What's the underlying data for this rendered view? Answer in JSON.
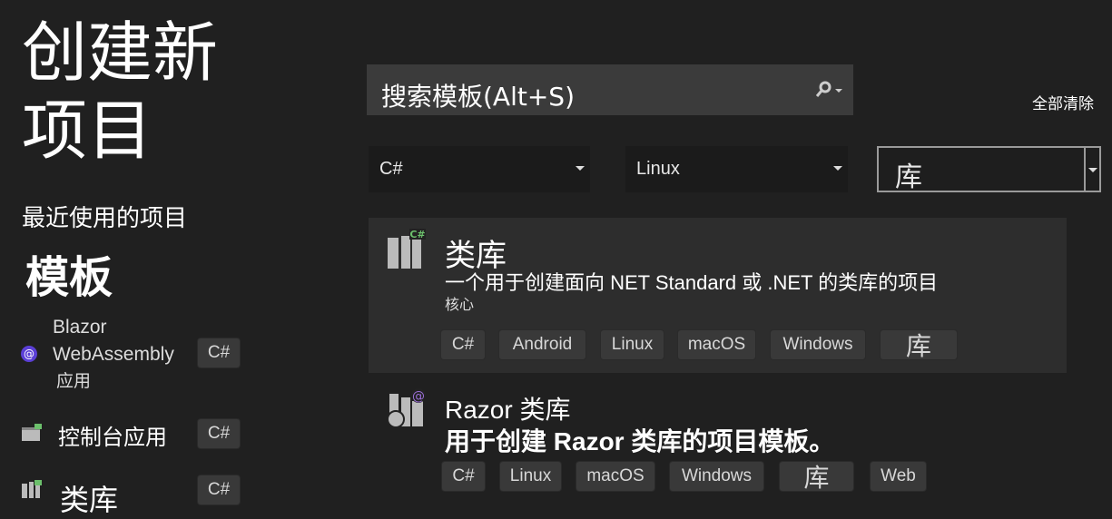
{
  "title_line1": "创建新",
  "title_line2": "项目",
  "recent_heading": "最近使用的项目",
  "templates_heading": "模板",
  "recent": [
    {
      "name_lines": [
        "Blazor",
        "WebAssembly",
        "应用"
      ],
      "tag": "C#",
      "icon": "blazor-icon"
    },
    {
      "name": "控制台应用",
      "tag": "C#",
      "icon": "console-app-icon"
    },
    {
      "name": "类库",
      "tag": "C#",
      "icon": "class-library-icon"
    }
  ],
  "search": {
    "placeholder": "搜索模板(Alt+S)"
  },
  "clear_all": "全部清除",
  "filters": {
    "language": "C#",
    "platform": "Linux",
    "project_type": "库"
  },
  "templates": [
    {
      "title": "类库",
      "description": "一个用于创建面向 NET Standard 或 .NET 的类库的项目",
      "subtitle": "核心",
      "tags": [
        "C#",
        "Android",
        "Linux",
        "macOS",
        "Windows",
        "库"
      ],
      "selected": true
    },
    {
      "title": "Razor 类库",
      "description": "用于创建 Razor 类库的项目模板。",
      "tags": [
        "C#",
        "Linux",
        "macOS",
        "Windows",
        "库",
        "Web"
      ],
      "selected": false
    }
  ],
  "colors": {
    "background": "#202020",
    "selected_card": "#2d2d2d",
    "tag": "#393939",
    "csharp_badge": "#6cc06c",
    "razor_badge": "#9b6fd8",
    "blazor": "#5b3fd6"
  }
}
